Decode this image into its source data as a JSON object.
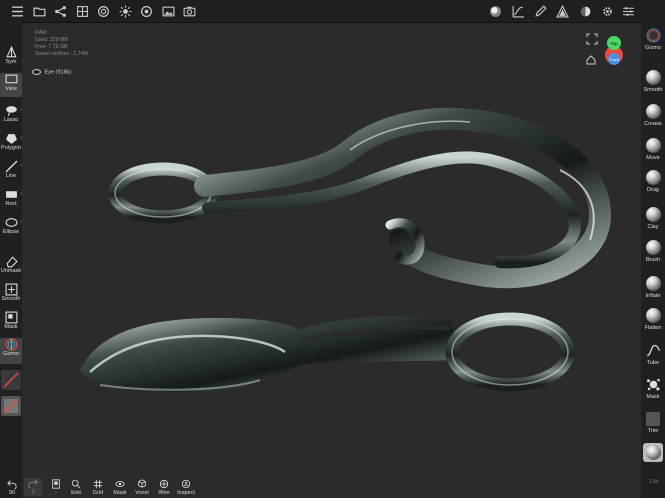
{
  "stats": {
    "title": "RAM",
    "used": "Used: 329 MB",
    "free": "Free: 7.76 GB",
    "vertices": "Scene vertices : 1.74M"
  },
  "object": {
    "name": "Eye (918k)"
  },
  "gizmo": {
    "top": "Top",
    "front": "Front"
  },
  "left_tools": [
    {
      "label": "Sym",
      "icon": "symmetry-icon"
    },
    {
      "label": "View",
      "icon": "view-icon"
    },
    {
      "label": "Lasso",
      "icon": "lasso-icon"
    },
    {
      "label": "Polygon",
      "icon": "polygon-icon"
    },
    {
      "label": "Line",
      "icon": "line-icon"
    },
    {
      "label": "Rect",
      "icon": "rect-icon"
    },
    {
      "label": "Ellipse",
      "icon": "ellipse-icon"
    },
    {
      "label": "Unmask",
      "icon": "eraser-icon"
    },
    {
      "label": "Smooth",
      "icon": "smooth-icon"
    },
    {
      "label": "Mask",
      "icon": "mask-icon"
    },
    {
      "label": "Gizmo",
      "icon": "gizmo-icon"
    }
  ],
  "right_tools": [
    {
      "label": "Gizmo"
    },
    {
      "label": "Smooth"
    },
    {
      "label": "Crease"
    },
    {
      "label": "Move"
    },
    {
      "label": "Drag"
    },
    {
      "label": "Clay"
    },
    {
      "label": "Brush"
    },
    {
      "label": "Inflate"
    },
    {
      "label": "Flatten"
    },
    {
      "label": "Tube"
    },
    {
      "label": "Mask"
    },
    {
      "label": "Trim"
    }
  ],
  "right_footer": "1.8k",
  "bottom_tools": [
    {
      "label": "90",
      "icon": "undo-icon"
    },
    {
      "label": "0",
      "icon": "redo-icon"
    },
    {
      "label": "",
      "icon": "display-icon"
    },
    {
      "label": "Solo",
      "icon": "solo-icon"
    },
    {
      "label": "Grid",
      "icon": "grid-icon"
    },
    {
      "label": "Mask",
      "icon": "mask-eye-icon"
    },
    {
      "label": "Voxel",
      "icon": "voxel-icon"
    },
    {
      "label": "Wire",
      "icon": "wire-icon"
    },
    {
      "label": "Inspect",
      "icon": "inspect-icon"
    }
  ],
  "colors": {
    "background": "#2b2b2b",
    "toolbar": "#1f1f1f",
    "gizmo_top": "#4cd964",
    "gizmo_front": "#4a90e2",
    "gizmo_right": "#e74c3c"
  }
}
